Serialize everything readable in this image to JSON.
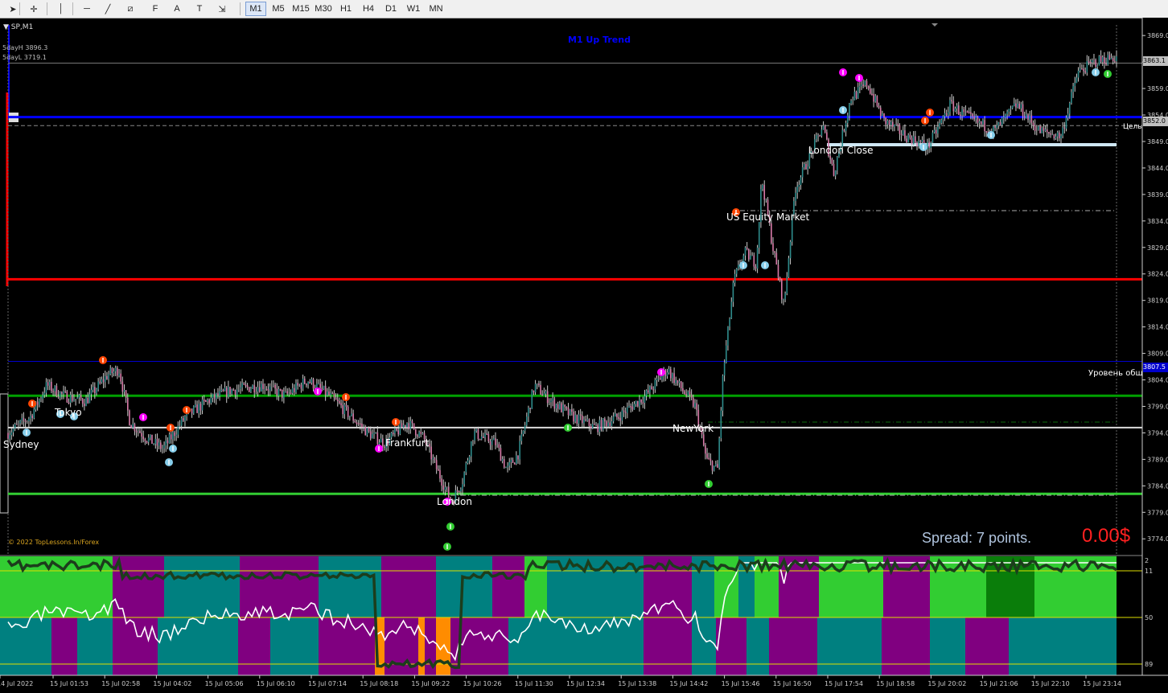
{
  "toolbar": {
    "tools": [
      "cursor-icon",
      "crosshair-icon",
      "vertical-line-icon",
      "horizontal-line-icon",
      "trendline-icon",
      "equidistant-channel-icon",
      "fibonacci-icon",
      "text-icon",
      "text-label-icon",
      "arrow-tools-icon"
    ],
    "tool_chars": [
      "➤",
      "✛",
      "│",
      "─",
      "╱",
      "⧄",
      "F",
      "A",
      "T",
      "⇲"
    ],
    "timeframes": [
      "M1",
      "M5",
      "M15",
      "M30",
      "H1",
      "H4",
      "D1",
      "W1",
      "MN"
    ],
    "active_timeframe": "M1"
  },
  "chart": {
    "symbol": "SP,M1",
    "trend_label": "M1 Up Trend",
    "five_day_high": "5dayH 3896.3",
    "five_day_low": "5dayL 3719.1",
    "copyright": "© 2022 TopLessons.In/Forex",
    "spread_text": "Spread: 7 points.",
    "profit_text": "0.00$",
    "current_price": "3863.1",
    "target_price": "3852.0",
    "general_level_price": "3807.5",
    "target_label": "Цель",
    "general_level_label": "Уровень общ",
    "sessions": {
      "sydney": "Sydney",
      "tokyo": "Tokyo",
      "frankfurt": "Frankfurt",
      "london": "London",
      "new_york": "NewYork",
      "us_equity": "US Equity Market",
      "london_close": "London Close"
    },
    "colors": {
      "background": "#000000",
      "current_price_line": "#0000ff",
      "target_line": "#ffffff",
      "red_level": "#ff0000",
      "green_level": "#00a000",
      "light_green_level": "#32cd32",
      "spread_text": "#b0c4de",
      "profit_text": "#ff2020",
      "indicator_teal": "#008080",
      "indicator_purple": "#800080",
      "indicator_green": "#32cd32",
      "indicator_orange": "#ff8c00"
    }
  },
  "chart_data": {
    "type": "candlestick",
    "symbol": "SP",
    "timeframe": "M1",
    "ylim": [
      3771,
      3871
    ],
    "price_ticks": [
      3869.0,
      3864.0,
      3859.0,
      3854.0,
      3849.0,
      3844.0,
      3839.0,
      3834.0,
      3829.0,
      3824.0,
      3819.0,
      3814.0,
      3809.0,
      3804.0,
      3799.0,
      3794.0,
      3789.0,
      3784.0,
      3779.0,
      3774.0
    ],
    "time_ticks": [
      "14 Jul 2022",
      "15 Jul 01:53",
      "15 Jul 02:58",
      "15 Jul 04:02",
      "15 Jul 05:06",
      "15 Jul 06:10",
      "15 Jul 07:14",
      "15 Jul 08:18",
      "15 Jul 09:22",
      "15 Jul 10:26",
      "15 Jul 11:30",
      "15 Jul 12:34",
      "15 Jul 13:38",
      "15 Jul 14:42",
      "15 Jul 15:46",
      "15 Jul 16:50",
      "15 Jul 17:54",
      "15 Jul 18:58",
      "15 Jul 20:02",
      "15 Jul 21:06",
      "15 Jul 22:10",
      "15 Jul 23:14"
    ],
    "price_path": [
      [
        0.0,
        3794
      ],
      [
        0.02,
        3797
      ],
      [
        0.035,
        3803
      ],
      [
        0.05,
        3801
      ],
      [
        0.07,
        3800
      ],
      [
        0.09,
        3805
      ],
      [
        0.1,
        3806
      ],
      [
        0.11,
        3796
      ],
      [
        0.125,
        3793
      ],
      [
        0.14,
        3791
      ],
      [
        0.16,
        3797
      ],
      [
        0.18,
        3800
      ],
      [
        0.2,
        3802
      ],
      [
        0.23,
        3803
      ],
      [
        0.25,
        3801
      ],
      [
        0.27,
        3804
      ],
      [
        0.29,
        3801
      ],
      [
        0.31,
        3797
      ],
      [
        0.325,
        3794
      ],
      [
        0.34,
        3792
      ],
      [
        0.36,
        3796
      ],
      [
        0.375,
        3793
      ],
      [
        0.385,
        3788
      ],
      [
        0.4,
        3781
      ],
      [
        0.41,
        3785
      ],
      [
        0.42,
        3794
      ],
      [
        0.44,
        3792
      ],
      [
        0.45,
        3787
      ],
      [
        0.46,
        3790
      ],
      [
        0.475,
        3803
      ],
      [
        0.49,
        3800
      ],
      [
        0.51,
        3797
      ],
      [
        0.53,
        3795
      ],
      [
        0.55,
        3797
      ],
      [
        0.575,
        3801
      ],
      [
        0.595,
        3806
      ],
      [
        0.605,
        3803
      ],
      [
        0.62,
        3799
      ],
      [
        0.63,
        3789
      ],
      [
        0.64,
        3787
      ],
      [
        0.645,
        3805
      ],
      [
        0.655,
        3823
      ],
      [
        0.665,
        3828
      ],
      [
        0.675,
        3826
      ],
      [
        0.68,
        3842
      ],
      [
        0.69,
        3829
      ],
      [
        0.7,
        3818
      ],
      [
        0.71,
        3840
      ],
      [
        0.725,
        3847
      ],
      [
        0.735,
        3852
      ],
      [
        0.745,
        3843
      ],
      [
        0.76,
        3857
      ],
      [
        0.775,
        3860
      ],
      [
        0.79,
        3853
      ],
      [
        0.81,
        3850
      ],
      [
        0.83,
        3848
      ],
      [
        0.85,
        3856
      ],
      [
        0.87,
        3853
      ],
      [
        0.89,
        3851
      ],
      [
        0.91,
        3856
      ],
      [
        0.93,
        3851
      ],
      [
        0.95,
        3850
      ],
      [
        0.965,
        3862
      ],
      [
        0.98,
        3864
      ],
      [
        1.0,
        3865
      ]
    ],
    "levels": [
      {
        "name": "current-price",
        "price": 3853.6
      },
      {
        "name": "target",
        "price": 3852.0
      },
      {
        "name": "red-level",
        "price": 3823.0
      },
      {
        "name": "general-level",
        "price": 3807.5
      },
      {
        "name": "green-level",
        "price": 3801.0
      },
      {
        "name": "white-level",
        "price": 3795.0
      },
      {
        "name": "light-green-level",
        "price": 3782.5
      }
    ],
    "indicator_levels": [
      "11",
      "50",
      "89"
    ]
  }
}
